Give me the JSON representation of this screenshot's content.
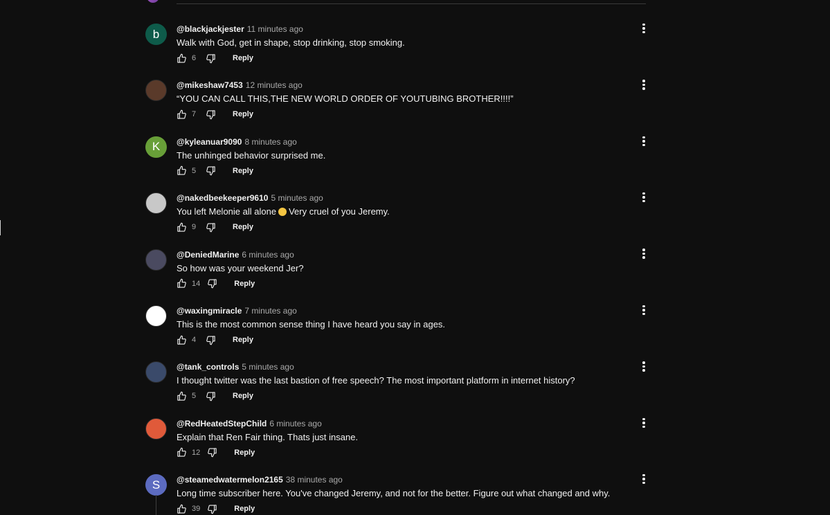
{
  "reply_label": "Reply",
  "comments": [
    {
      "author": "@blackjackjester",
      "time": "11 minutes ago",
      "text": "Walk with God, get in shape, stop drinking, stop smoking.",
      "likes": "6",
      "avatar": {
        "type": "letter",
        "letter": "b",
        "color": "#0e5b4a"
      }
    },
    {
      "author": "@mikeshaw7453",
      "time": "12 minutes ago",
      "text": "“YOU CAN CALL THIS,THE NEW WORLD ORDER OF YOUTUBING BROTHER!!!!”",
      "likes": "7",
      "avatar": {
        "type": "image",
        "color": "#5a3a2a"
      }
    },
    {
      "author": "@kyleanuar9090",
      "time": "8 minutes ago",
      "text": "The unhinged behavior surprised me.",
      "likes": "5",
      "avatar": {
        "type": "letter",
        "letter": "K",
        "color": "#689f38"
      }
    },
    {
      "author": "@nakedbeekeeper9610",
      "time": "5 minutes ago",
      "text_before": "You left Melonie all alone",
      "text_after": "Very cruel of you Jeremy.",
      "emoji": "worried-face-emoji",
      "likes": "9",
      "avatar": {
        "type": "image",
        "color": "#c8c8c8"
      }
    },
    {
      "author": "@DeniedMarine",
      "time": "6 minutes ago",
      "text": "So how was your weekend Jer?",
      "likes": "14",
      "avatar": {
        "type": "image",
        "color": "#4a4a60"
      }
    },
    {
      "author": "@waxingmiracle",
      "time": "7 minutes ago",
      "text": "This is the most common sense thing I have heard you say in ages.",
      "likes": "4",
      "avatar": {
        "type": "image",
        "color": "#ffffff"
      }
    },
    {
      "author": "@tank_controls",
      "time": "5 minutes ago",
      "text": "I thought twitter was the last bastion of free speech? The most important platform in internet history?",
      "likes": "5",
      "avatar": {
        "type": "image",
        "color": "#3a4a6a"
      }
    },
    {
      "author": "@RedHeatedStepChild",
      "time": "6 minutes ago",
      "text": "Explain that Ren Fair thing. Thats just insane.",
      "likes": "12",
      "avatar": {
        "type": "image",
        "color": "#e05a3a"
      }
    },
    {
      "author": "@steamedwatermelon2165",
      "time": "38 minutes ago",
      "text": "Long time subscriber here. You've changed Jeremy, and not for the better. Figure out what changed and why.",
      "likes": "39",
      "avatar": {
        "type": "letter",
        "letter": "S",
        "color": "#5c6bc0"
      }
    }
  ]
}
